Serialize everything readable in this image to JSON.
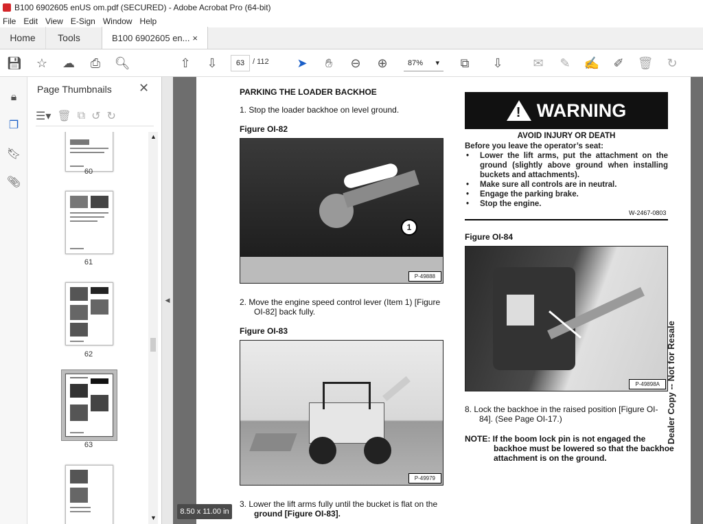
{
  "window": {
    "title": "B100 6902605 enUS om.pdf (SECURED) - Adobe Acrobat Pro (64-bit)"
  },
  "menu": [
    "File",
    "Edit",
    "View",
    "E-Sign",
    "Window",
    "Help"
  ],
  "tabs": {
    "home": "Home",
    "tools": "Tools",
    "doc": "B100 6902605 en...",
    "close": "×"
  },
  "toolbar": {
    "page_current": "63",
    "page_total": "/ 112",
    "zoom": "87%"
  },
  "panel": {
    "title": "Page Thumbnails",
    "close": "✕"
  },
  "thumbnails": [
    {
      "label": "60"
    },
    {
      "label": "61"
    },
    {
      "label": "62"
    },
    {
      "label": "63",
      "selected": true
    },
    {
      "label": ""
    }
  ],
  "page_size_badge": "8.50 x 11.00 in",
  "document": {
    "heading": "PARKING THE LOADER BACKHOE",
    "step1": "1.   Stop the loader backhoe on level ground.",
    "fig82": "Figure OI-82",
    "fig82_num": "P-49888",
    "fig82_callout": "1",
    "step2_a": "2.   Move the engine speed control lever (Item 1) [Figure",
    "step2_b": "OI-82] back fully.",
    "fig83": "Figure OI-83",
    "fig83_num": "P-49979",
    "step3_a": "3.   Lower the lift arms fully until the bucket is flat on the",
    "step3_b": "ground [Figure OI-83].",
    "warning_title": "WARNING",
    "warning_sub": "AVOID INJURY OR DEATH",
    "warning_intro": "Before you leave the operator’s seat:",
    "warning_items": [
      "Lower the lift arms, put the attachment on the ground (slightly above ground when installing buckets and attachments).",
      "Make sure all controls are in neutral.",
      "Engage the parking brake.",
      "Stop the engine."
    ],
    "warning_code": "W-2467-0803",
    "fig84": "Figure OI-84",
    "fig84_num": "P-49898A",
    "step8_a": "8.   Lock the backhoe in the raised position   [Figure OI-",
    "step8_b": "84]. (See Page OI-17.)",
    "note_a": "NOTE:  If the boom lock pin is not engaged the",
    "note_b": "backhoe must be lowered so that the backhoe",
    "note_c": "attachment is on the ground.",
    "sidebar": "Dealer Copy -- Not for Resale"
  }
}
